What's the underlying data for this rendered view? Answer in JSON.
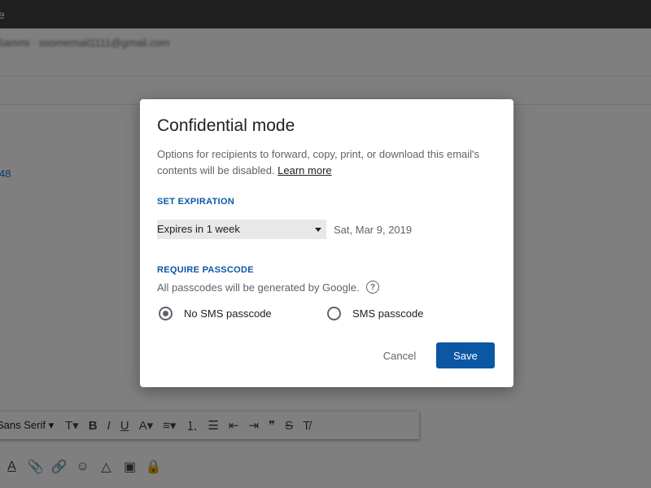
{
  "window": {
    "title_fragment": "e"
  },
  "compose": {
    "from_email": "Sammi · ssomemail1111@gmail.com",
    "body_snippet": "48",
    "font_family": "Sans Serif",
    "format_tools": [
      "text-size-icon",
      "bold-icon",
      "italic-icon",
      "underline-icon",
      "text-color-icon",
      "align-icon",
      "numbered-list-icon",
      "bulleted-list-icon",
      "indent-less-icon",
      "indent-more-icon",
      "quote-icon",
      "strikethrough-icon",
      "remove-formatting-icon"
    ],
    "bottom_tools": [
      "formatting-icon",
      "attach-icon",
      "link-icon",
      "emoji-icon",
      "drive-icon",
      "photo-icon",
      "confidential-icon"
    ]
  },
  "dialog": {
    "title": "Confidential mode",
    "description": "Options for recipients to forward, copy, print, or download this email's contents will be disabled.",
    "learn_more": "Learn more",
    "set_expiration_label": "SET EXPIRATION",
    "expiration_selected": "Expires in 1 week",
    "expiration_date": "Sat, Mar 9, 2019",
    "require_passcode_label": "REQUIRE PASSCODE",
    "passcode_note": "All passcodes will be generated by Google.",
    "help_glyph": "?",
    "passcode_options": [
      {
        "label": "No SMS passcode",
        "checked": true
      },
      {
        "label": "SMS passcode",
        "checked": false
      }
    ],
    "cancel_label": "Cancel",
    "save_label": "Save"
  },
  "colors": {
    "accent": "#0b57a4",
    "scrim": "#000000",
    "topbar": "#404040"
  }
}
